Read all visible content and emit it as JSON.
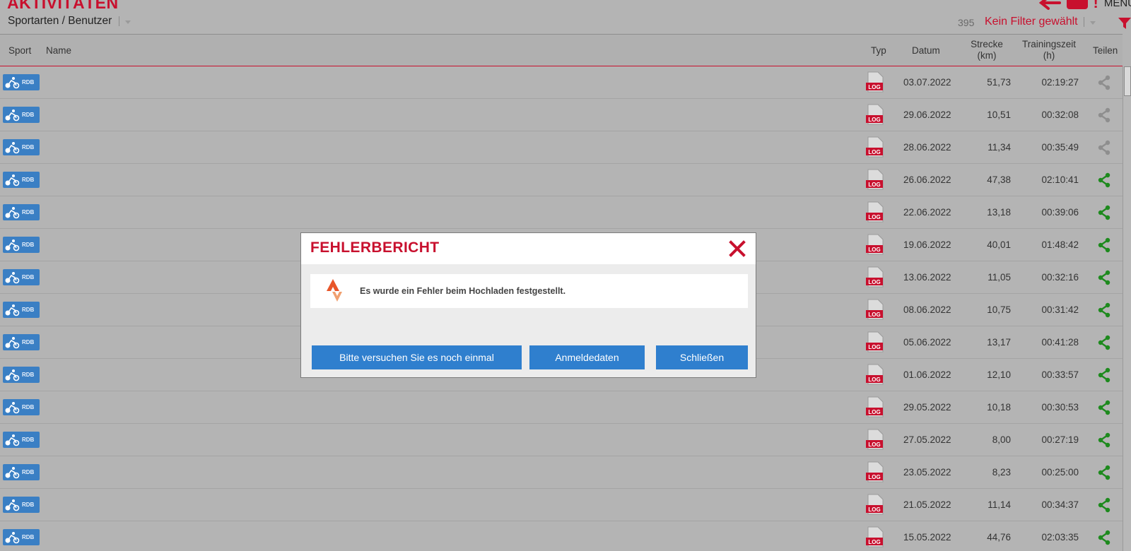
{
  "app": {
    "title": "AKTIVITÄTEN",
    "menu_label": "MENÜ",
    "accent_color": "#c8102e",
    "icons": [
      "back-arrow-icon",
      "sync-icon",
      "exclamation-icon"
    ]
  },
  "toolbar": {
    "filter_label": "Sportarten / Benutzer",
    "count": "395",
    "filter_status": "Kein Filter gewählt",
    "icons": [
      "chevron-down-icon",
      "funnel-icon"
    ]
  },
  "table": {
    "headers": {
      "sport": "Sport",
      "name": "Name",
      "typ": "Typ",
      "datum": "Datum",
      "strecke_1": "Strecke",
      "strecke_2": "(km)",
      "zeit_1": "Trainingszeit",
      "zeit_2": "(h)",
      "teilen": "Teilen"
    },
    "sport_code": "RDB",
    "type_label": "LOG",
    "rows": [
      {
        "date": "03.07.2022",
        "distance": "51,73",
        "time": "02:19:27",
        "shared": false
      },
      {
        "date": "29.06.2022",
        "distance": "10,51",
        "time": "00:32:08",
        "shared": false
      },
      {
        "date": "28.06.2022",
        "distance": "11,34",
        "time": "00:35:49",
        "shared": false
      },
      {
        "date": "26.06.2022",
        "distance": "47,38",
        "time": "02:10:41",
        "shared": true
      },
      {
        "date": "22.06.2022",
        "distance": "13,18",
        "time": "00:39:06",
        "shared": true
      },
      {
        "date": "19.06.2022",
        "distance": "40,01",
        "time": "01:48:42",
        "shared": true
      },
      {
        "date": "13.06.2022",
        "distance": "11,05",
        "time": "00:32:16",
        "shared": true
      },
      {
        "date": "08.06.2022",
        "distance": "10,75",
        "time": "00:31:42",
        "shared": true
      },
      {
        "date": "05.06.2022",
        "distance": "13,17",
        "time": "00:41:28",
        "shared": true
      },
      {
        "date": "01.06.2022",
        "distance": "12,10",
        "time": "00:33:57",
        "shared": true
      },
      {
        "date": "29.05.2022",
        "distance": "10,18",
        "time": "00:30:53",
        "shared": true
      },
      {
        "date": "27.05.2022",
        "distance": "8,00",
        "time": "00:27:19",
        "shared": true
      },
      {
        "date": "23.05.2022",
        "distance": "8,23",
        "time": "00:25:00",
        "shared": true
      },
      {
        "date": "21.05.2022",
        "distance": "11,14",
        "time": "00:34:37",
        "shared": true
      },
      {
        "date": "15.05.2022",
        "distance": "44,76",
        "time": "02:03:35",
        "shared": true
      }
    ],
    "share_colors": {
      "active": "#1e8a1e",
      "inactive": "#8e8e8e"
    }
  },
  "dialog": {
    "title": "FEHLERBERICHT",
    "message": "Es wurde ein Fehler beim Hochladen festgestellt.",
    "buttons": {
      "retry": "Bitte versuchen Sie es noch einmal",
      "login": "Anmeldedaten",
      "close": "Schließen"
    },
    "icons": [
      "close-icon",
      "strava-icon"
    ]
  }
}
